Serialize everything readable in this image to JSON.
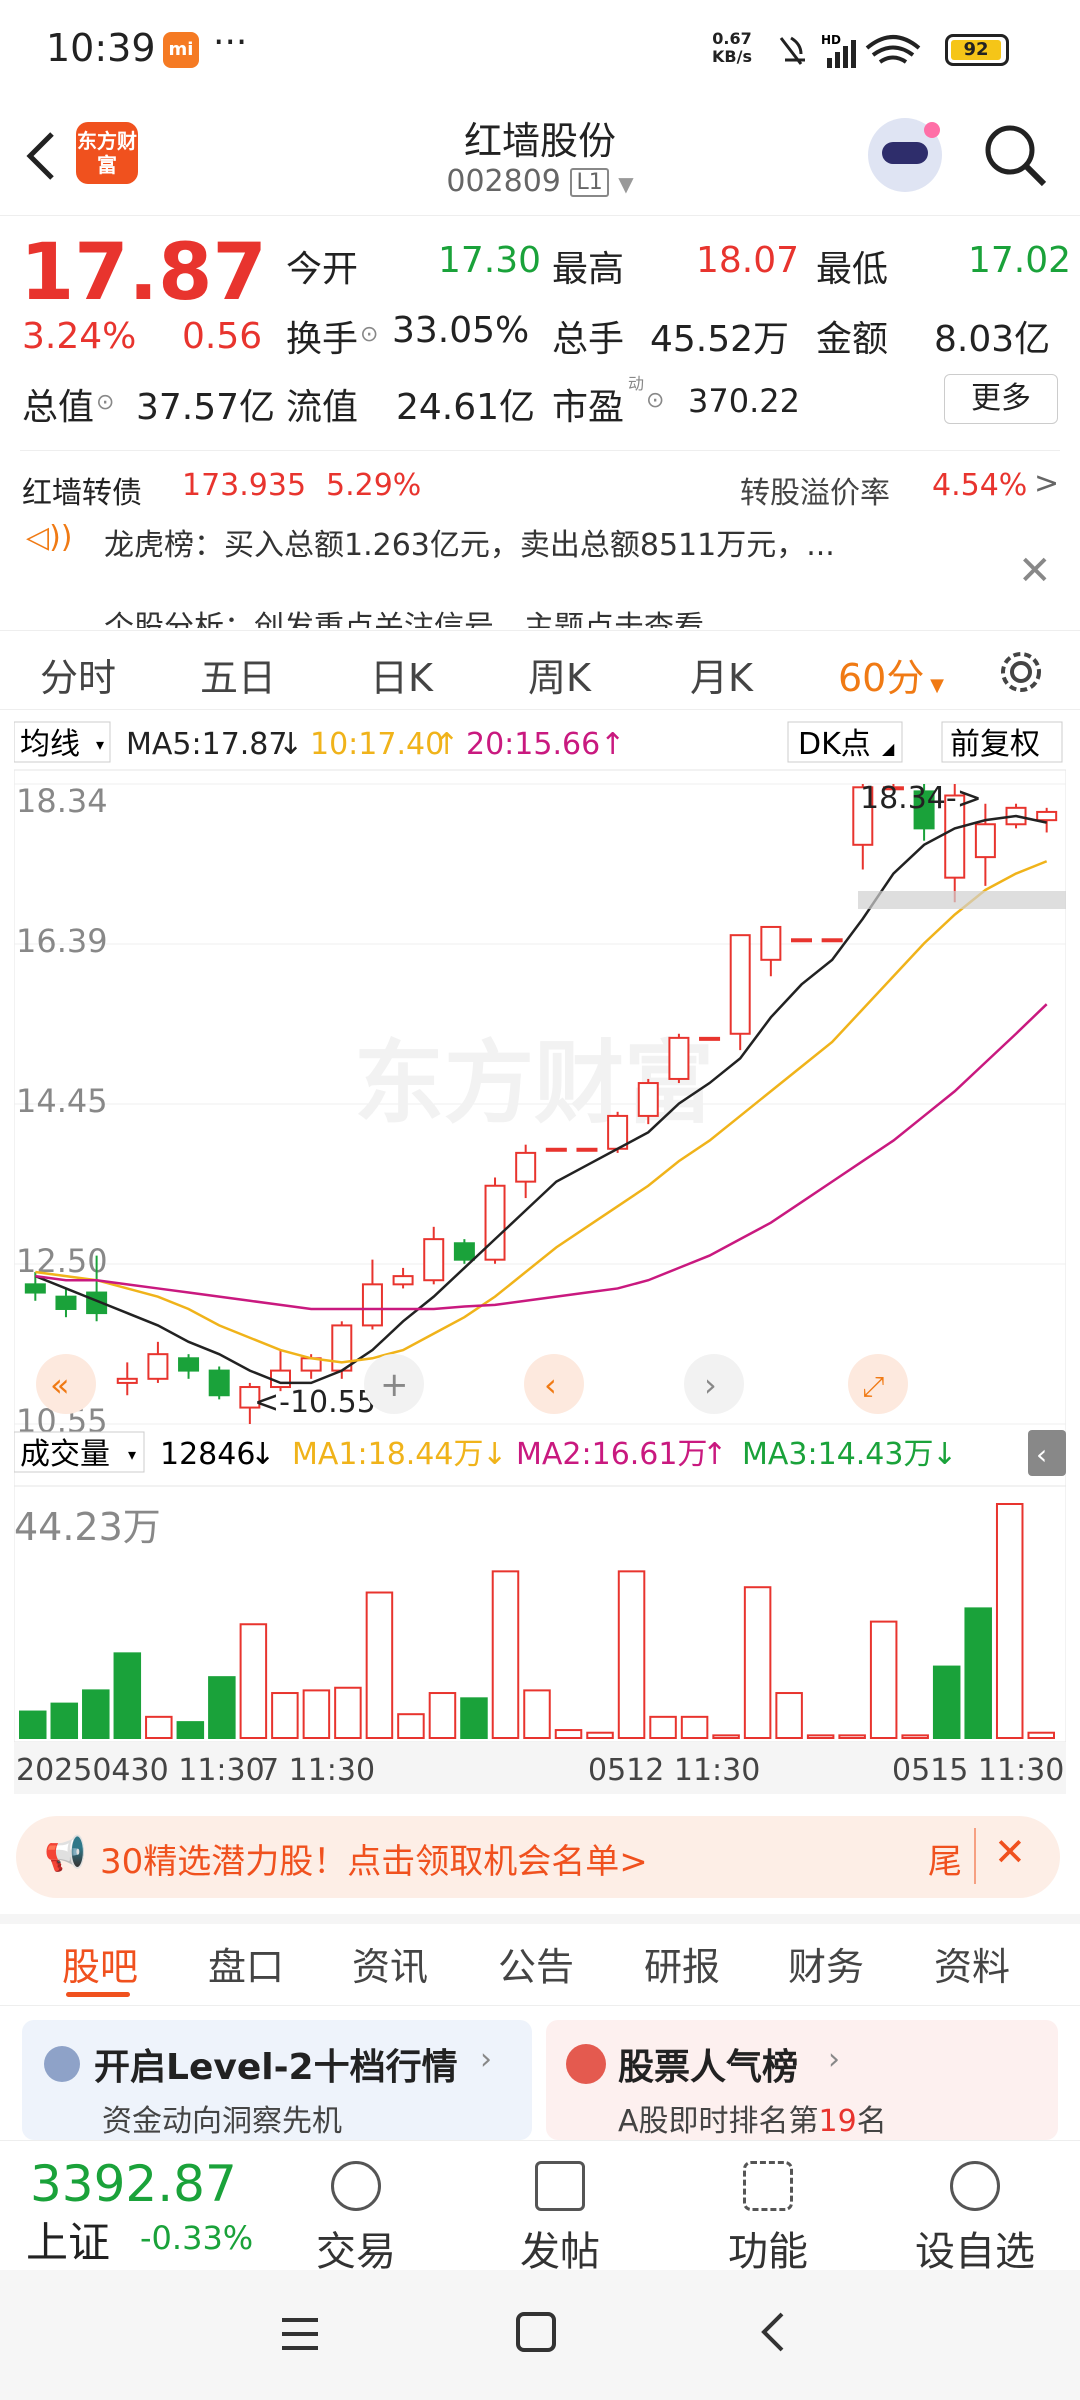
{
  "status_bar": {
    "time": "10:39",
    "net_speed": "0.67",
    "net_unit": "KB/s",
    "battery": "92"
  },
  "header": {
    "logo": "东方财富",
    "title": "红墙股份",
    "code": "002809",
    "level": "L1"
  },
  "quote": {
    "price": "17.87",
    "change_pct": "3.24%",
    "change_amt": "0.56",
    "open_label": "今开",
    "open": "17.30",
    "high_label": "最高",
    "high": "18.07",
    "low_label": "最低",
    "low": "17.02",
    "turnover_label": "换手",
    "turnover": "33.05%",
    "volume_label": "总手",
    "volume": "45.52万",
    "amount_label": "金额",
    "amount": "8.03亿",
    "mktcap_label": "总值",
    "mktcap": "37.57亿",
    "float_label": "流值",
    "float": "24.61亿",
    "pe_label": "市盈",
    "pe_sup": "动",
    "pe": "370.22",
    "more_label": "更多"
  },
  "bond": {
    "name": "红墙转债",
    "price": "173.935",
    "change": "5.29%",
    "premium_label": "转股溢价率",
    "premium": "4.54%"
  },
  "news": {
    "line1": "龙虎榜：买入总额1.263亿元，卖出总额8511万元，...",
    "line2": "个股分析：创发重点关注信号，主题点击查看"
  },
  "kline_tabs": [
    "分时",
    "五日",
    "日K",
    "周K",
    "月K",
    "60分"
  ],
  "ma_bar": {
    "type": "均线",
    "ma5": "MA5:17.87",
    "ma10": "10:17.40",
    "ma20": "20:15.66",
    "dk": "DK点",
    "adjust": "前复权"
  },
  "price_axis": [
    "18.34",
    "16.39",
    "14.45",
    "12.50",
    "10.55"
  ],
  "annotations": {
    "high": "18.34->",
    "low": "<-10.55"
  },
  "vol_bar": {
    "type": "成交量",
    "vol": "12846",
    "ma1": "MA1:18.44万",
    "ma2": "MA2:16.61万",
    "ma3": "MA3:14.43万",
    "max_label": "44.23万"
  },
  "time_axis": [
    "20250430 11:30",
    "7 11:30",
    "0512 11:30",
    "0515 11:30"
  ],
  "promo": {
    "text": "30精选潜力股！点击领取机会名单>",
    "tail": "尾"
  },
  "bottom_tabs": [
    "股吧",
    "盘口",
    "资讯",
    "公告",
    "研报",
    "财务",
    "资料"
  ],
  "cards": [
    {
      "title": "开启Level-2十档行情",
      "sub": "资金动向洞察先机"
    },
    {
      "title": "股票人气榜",
      "sub_pre": "A股即时排名第",
      "sub_num": "19",
      "sub_post": "名"
    }
  ],
  "index": {
    "value": "3392.87",
    "name": "上证",
    "change": "-0.33%"
  },
  "footer_buttons": [
    "交易",
    "发帖",
    "功能",
    "设自选"
  ],
  "colors": {
    "up": "#e8342e",
    "down": "#1aa23a",
    "ma5": "#222222",
    "ma10": "#f0b31a",
    "ma20": "#c9197f",
    "accent": "#f07a14"
  },
  "chart_data": {
    "type": "candlestick",
    "ylim": [
      10.55,
      18.34
    ],
    "candles": [
      {
        "o": 12.25,
        "c": 12.15,
        "h": 12.4,
        "l": 12.05
      },
      {
        "o": 12.1,
        "c": 11.95,
        "h": 12.2,
        "l": 11.85
      },
      {
        "o": 12.15,
        "c": 11.9,
        "h": 12.6,
        "l": 11.8
      },
      {
        "o": 11.05,
        "c": 11.1,
        "h": 11.3,
        "l": 10.9
      },
      {
        "o": 11.1,
        "c": 11.4,
        "h": 11.55,
        "l": 11.05
      },
      {
        "o": 11.35,
        "c": 11.2,
        "h": 11.4,
        "l": 11.1
      },
      {
        "o": 11.2,
        "c": 10.9,
        "h": 11.25,
        "l": 10.85
      },
      {
        "o": 10.75,
        "c": 11.0,
        "h": 11.05,
        "l": 10.55
      },
      {
        "o": 11.0,
        "c": 11.2,
        "h": 11.45,
        "l": 10.95
      },
      {
        "o": 11.2,
        "c": 11.35,
        "h": 11.4,
        "l": 11.1
      },
      {
        "o": 11.2,
        "c": 11.75,
        "h": 11.8,
        "l": 11.1
      },
      {
        "o": 11.75,
        "c": 12.25,
        "h": 12.55,
        "l": 11.7
      },
      {
        "o": 12.25,
        "c": 12.35,
        "h": 12.45,
        "l": 12.2
      },
      {
        "o": 12.3,
        "c": 12.8,
        "h": 12.95,
        "l": 12.25
      },
      {
        "o": 12.75,
        "c": 12.55,
        "h": 12.8,
        "l": 12.5
      },
      {
        "o": 12.55,
        "c": 13.45,
        "h": 13.55,
        "l": 12.5
      },
      {
        "o": 13.5,
        "c": 13.85,
        "h": 13.95,
        "l": 13.3
      },
      {
        "o": 13.9,
        "c": 13.9,
        "h": 13.9,
        "l": 13.9
      },
      {
        "o": 13.9,
        "c": 13.9,
        "h": 13.9,
        "l": 13.9
      },
      {
        "o": 13.9,
        "c": 14.3,
        "h": 14.35,
        "l": 13.85
      },
      {
        "o": 14.3,
        "c": 14.7,
        "h": 14.75,
        "l": 14.2
      },
      {
        "o": 14.75,
        "c": 15.25,
        "h": 15.3,
        "l": 14.7
      },
      {
        "o": 15.25,
        "c": 15.25,
        "h": 15.25,
        "l": 15.25
      },
      {
        "o": 15.3,
        "c": 16.5,
        "h": 16.45,
        "l": 15.1
      },
      {
        "o": 16.2,
        "c": 16.6,
        "h": 16.45,
        "l": 16.0
      },
      {
        "o": 16.45,
        "c": 16.45,
        "h": 16.45,
        "l": 16.45
      },
      {
        "o": 16.45,
        "c": 16.45,
        "h": 16.45,
        "l": 16.45
      },
      {
        "o": 17.6,
        "c": 18.3,
        "h": 18.34,
        "l": 17.3
      },
      {
        "o": 18.3,
        "c": 18.3,
        "h": 18.34,
        "l": 18.3
      },
      {
        "o": 18.25,
        "c": 17.8,
        "h": 18.34,
        "l": 17.65
      },
      {
        "o": 17.2,
        "c": 18.2,
        "h": 18.34,
        "l": 16.9
      },
      {
        "o": 17.45,
        "c": 17.85,
        "h": 18.1,
        "l": 17.1
      },
      {
        "o": 17.85,
        "c": 18.05,
        "h": 18.1,
        "l": 17.8
      },
      {
        "o": 17.9,
        "c": 18.0,
        "h": 18.05,
        "l": 17.75
      }
    ],
    "ma5": [
      12.35,
      12.2,
      12.05,
      11.9,
      11.75,
      11.55,
      11.4,
      11.2,
      11.05,
      11.05,
      11.2,
      11.45,
      11.8,
      12.1,
      12.45,
      12.8,
      13.15,
      13.5,
      13.7,
      13.9,
      14.1,
      14.45,
      14.7,
      15.0,
      15.5,
      15.9,
      16.2,
      16.7,
      17.25,
      17.6,
      17.8,
      17.9,
      17.95,
      17.87
    ],
    "ma10": [
      12.4,
      12.35,
      12.3,
      12.2,
      12.1,
      11.95,
      11.75,
      11.6,
      11.45,
      11.35,
      11.3,
      11.35,
      11.45,
      11.65,
      11.85,
      12.1,
      12.4,
      12.7,
      12.95,
      13.2,
      13.45,
      13.75,
      14.0,
      14.3,
      14.6,
      14.9,
      15.2,
      15.6,
      16.0,
      16.4,
      16.75,
      17.05,
      17.25,
      17.4
    ],
    "ma20": [
      12.35,
      12.3,
      12.3,
      12.25,
      12.2,
      12.15,
      12.1,
      12.05,
      12.0,
      11.95,
      11.95,
      11.95,
      11.95,
      11.95,
      11.98,
      12.0,
      12.05,
      12.1,
      12.15,
      12.2,
      12.3,
      12.45,
      12.6,
      12.8,
      13.0,
      13.25,
      13.5,
      13.75,
      14.0,
      14.3,
      14.6,
      14.95,
      15.3,
      15.66
    ],
    "volume": [
      {
        "v": 5,
        "up": false
      },
      {
        "v": 6.5,
        "up": false
      },
      {
        "v": 9,
        "up": false
      },
      {
        "v": 16,
        "up": false
      },
      {
        "v": 4,
        "up": true
      },
      {
        "v": 3,
        "up": false
      },
      {
        "v": 11.5,
        "up": false
      },
      {
        "v": 21.5,
        "up": true
      },
      {
        "v": 8.5,
        "up": true
      },
      {
        "v": 9,
        "up": true
      },
      {
        "v": 9.5,
        "up": true
      },
      {
        "v": 27.5,
        "up": true
      },
      {
        "v": 4.5,
        "up": true
      },
      {
        "v": 8.5,
        "up": true
      },
      {
        "v": 7.5,
        "up": false
      },
      {
        "v": 31.5,
        "up": true
      },
      {
        "v": 9,
        "up": true
      },
      {
        "v": 1.5,
        "up": true
      },
      {
        "v": 1,
        "up": true
      },
      {
        "v": 31.5,
        "up": true
      },
      {
        "v": 4,
        "up": true
      },
      {
        "v": 4,
        "up": true
      },
      {
        "v": 0.5,
        "up": true
      },
      {
        "v": 28.5,
        "up": true
      },
      {
        "v": 8.5,
        "up": true
      },
      {
        "v": 0.5,
        "up": true
      },
      {
        "v": 0.5,
        "up": true
      },
      {
        "v": 22,
        "up": true
      },
      {
        "v": 0.5,
        "up": true
      },
      {
        "v": 13.5,
        "up": false
      },
      {
        "v": 24.5,
        "up": false
      },
      {
        "v": 44.23,
        "up": true
      },
      {
        "v": 1,
        "up": true
      }
    ],
    "vol_ylim": [
      0,
      44.23
    ]
  }
}
